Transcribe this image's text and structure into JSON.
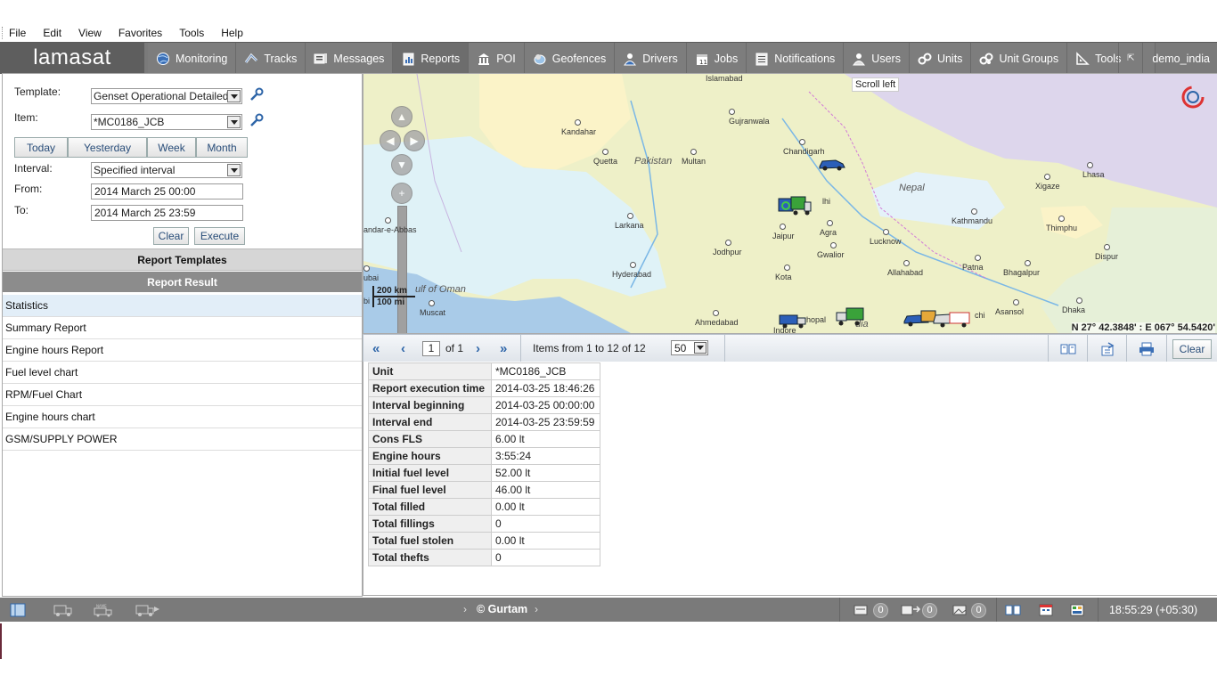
{
  "menu": [
    "File",
    "Edit",
    "View",
    "Favorites",
    "Tools",
    "Help"
  ],
  "app": {
    "logo": "lamasat",
    "user": "demo_india"
  },
  "nav_tabs": [
    {
      "label": "Monitoring",
      "icon": "globe-icon"
    },
    {
      "label": "Tracks",
      "icon": "tracks-icon"
    },
    {
      "label": "Messages",
      "icon": "messages-icon"
    },
    {
      "label": "Reports",
      "icon": "reports-icon",
      "active": true
    },
    {
      "label": "POI",
      "icon": "poi-icon"
    },
    {
      "label": "Geofences",
      "icon": "geofences-icon"
    },
    {
      "label": "Drivers",
      "icon": "driver-icon"
    },
    {
      "label": "Jobs",
      "icon": "jobs-icon"
    },
    {
      "label": "Notifications",
      "icon": "notifications-icon"
    },
    {
      "label": "Users",
      "icon": "users-icon"
    },
    {
      "label": "Units",
      "icon": "units-icon"
    },
    {
      "label": "Unit Groups",
      "icon": "unit-groups-icon"
    },
    {
      "label": "Tools",
      "icon": "tools-icon"
    }
  ],
  "report_form": {
    "template_label": "Template:",
    "template_value": "Genset Operational Detailed",
    "item_label": "Item:",
    "item_value": "*MC0186_JCB",
    "day_buttons": [
      "Today",
      "Yesterday",
      "Week",
      "Month"
    ],
    "interval_label": "Interval:",
    "interval_value": "Specified interval",
    "from_label": "From:",
    "from_value": "2014 March 25 00:00",
    "to_label": "To:",
    "to_value": "2014 March 25 23:59",
    "clear_label": "Clear",
    "execute_label": "Execute"
  },
  "sections": {
    "templates": "Report Templates",
    "result": "Report Result"
  },
  "result_items": [
    "Statistics",
    "Summary Report",
    "Engine hours Report",
    "Fuel level chart",
    "RPM/Fuel Chart",
    "Engine hours chart",
    "GSM/SUPPLY POWER"
  ],
  "map": {
    "tooltip": "Scroll left",
    "coords": "N 27° 42.3848' : E 067° 54.5420'",
    "scale_km": "200 km",
    "scale_mi": "100 mi",
    "cities": [
      {
        "name": "Islamabad"
      },
      {
        "name": "Gujranwala"
      },
      {
        "name": "Kandahar"
      },
      {
        "name": "Quetta"
      },
      {
        "name": "Multan"
      },
      {
        "name": "Chandigarh"
      },
      {
        "name": "Xigaze"
      },
      {
        "name": "Lhasa"
      },
      {
        "name": "Larkana"
      },
      {
        "name": "Jaipur"
      },
      {
        "name": "Agra"
      },
      {
        "name": "Lucknow"
      },
      {
        "name": "Kathmandu"
      },
      {
        "name": "Thimphu"
      },
      {
        "name": "Dispur"
      },
      {
        "name": "Jodhpur"
      },
      {
        "name": "Gwalior"
      },
      {
        "name": "Allahabad"
      },
      {
        "name": "Patna"
      },
      {
        "name": "Bhagalpur"
      },
      {
        "name": "Hyderabad"
      },
      {
        "name": "Kota"
      },
      {
        "name": "Asansol"
      },
      {
        "name": "Dhaka"
      },
      {
        "name": "Muscat"
      },
      {
        "name": "Ahmedabad"
      },
      {
        "name": "andar-e-Abbas"
      },
      {
        "name": "lhi"
      },
      {
        "name": "ubai"
      },
      {
        "name": "bi"
      },
      {
        "name": "hopal"
      },
      {
        "name": "chi"
      },
      {
        "name": "Indore"
      }
    ],
    "countries": [
      {
        "name": "Pakistan"
      },
      {
        "name": "Nepal"
      },
      {
        "name": "ulf of Oman"
      },
      {
        "name": "dia"
      }
    ]
  },
  "pager": {
    "page": "1",
    "of": "of 1",
    "items_text": "Items from 1 to 12 of 12",
    "per_page": "50",
    "clear_label": "Clear"
  },
  "stats_table": [
    {
      "key": "Unit",
      "value": "*MC0186_JCB"
    },
    {
      "key": "Report execution time",
      "value": "2014-03-25 18:46:26"
    },
    {
      "key": "Interval beginning",
      "value": "2014-03-25 00:00:00"
    },
    {
      "key": "Interval end",
      "value": "2014-03-25 23:59:59"
    },
    {
      "key": "Cons FLS",
      "value": "6.00 lt"
    },
    {
      "key": "Engine hours",
      "value": "3:55:24"
    },
    {
      "key": "Initial fuel level",
      "value": "52.00 lt"
    },
    {
      "key": "Final fuel level",
      "value": "46.00 lt"
    },
    {
      "key": "Total filled",
      "value": "0.00 lt"
    },
    {
      "key": "Total fillings",
      "value": "0"
    },
    {
      "key": "Total fuel stolen",
      "value": "0.00 lt"
    },
    {
      "key": "Total thefts",
      "value": "0"
    }
  ],
  "statusbar": {
    "copyright": "© Gurtam",
    "counts": [
      "0",
      "0",
      "0"
    ],
    "time": "18:55:29 (+05:30)"
  }
}
